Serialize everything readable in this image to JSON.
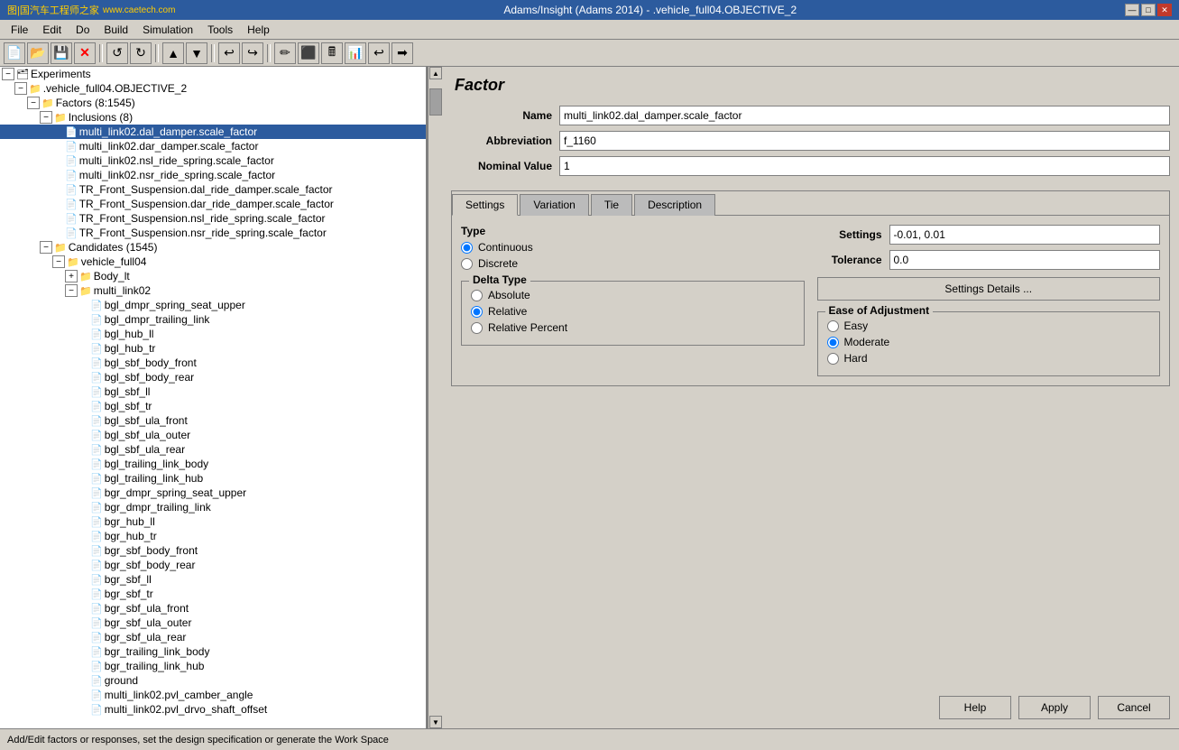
{
  "window": {
    "title": "Adams/Insight (Adams 2014) - .vehicle_full04.OBJECTIVE_2",
    "logo_text": "图|国汽车工程师之家",
    "sub_text": "www.caetech.com"
  },
  "titlebar": {
    "minimize": "—",
    "maximize": "□",
    "close": "✕"
  },
  "menu": {
    "items": [
      "File",
      "Edit",
      "Do",
      "Build",
      "Simulation",
      "Tools",
      "Help"
    ]
  },
  "toolbar_buttons": [
    "📄",
    "📂",
    "💾",
    "✕",
    "↺",
    "↻",
    "▲",
    "▼",
    "↩",
    "↪",
    "✏",
    "⬛",
    "🖩",
    "📊",
    "↩",
    "➡"
  ],
  "left_panel": {
    "tree": [
      {
        "label": "Experiments",
        "indent": 0,
        "expander": "−",
        "type": "folder"
      },
      {
        "label": ".vehicle_full04.OBJECTIVE_2",
        "indent": 1,
        "expander": "−",
        "type": "folder"
      },
      {
        "label": "Factors (8:1545)",
        "indent": 2,
        "expander": "−",
        "type": "folder"
      },
      {
        "label": "Inclusions (8)",
        "indent": 3,
        "expander": "−",
        "type": "folder"
      },
      {
        "label": "multi_link02.dal_damper.scale_factor",
        "indent": 4,
        "expander": null,
        "type": "item",
        "selected": true
      },
      {
        "label": "multi_link02.dar_damper.scale_factor",
        "indent": 4,
        "expander": null,
        "type": "item"
      },
      {
        "label": "multi_link02.nsl_ride_spring.scale_factor",
        "indent": 4,
        "expander": null,
        "type": "item"
      },
      {
        "label": "multi_link02.nsr_ride_spring.scale_factor",
        "indent": 4,
        "expander": null,
        "type": "item"
      },
      {
        "label": "TR_Front_Suspension.dal_ride_damper.scale_factor",
        "indent": 4,
        "expander": null,
        "type": "item"
      },
      {
        "label": "TR_Front_Suspension.dar_ride_damper.scale_factor",
        "indent": 4,
        "expander": null,
        "type": "item"
      },
      {
        "label": "TR_Front_Suspension.nsl_ride_spring.scale_factor",
        "indent": 4,
        "expander": null,
        "type": "item"
      },
      {
        "label": "TR_Front_Suspension.nsr_ride_spring.scale_factor",
        "indent": 4,
        "expander": null,
        "type": "item"
      },
      {
        "label": "Candidates (1545)",
        "indent": 3,
        "expander": "−",
        "type": "folder"
      },
      {
        "label": "vehicle_full04",
        "indent": 4,
        "expander": "−",
        "type": "folder"
      },
      {
        "label": "Body_lt",
        "indent": 5,
        "expander": "+",
        "type": "folder"
      },
      {
        "label": "multi_link02",
        "indent": 5,
        "expander": "−",
        "type": "folder"
      },
      {
        "label": "bgl_dmpr_spring_seat_upper",
        "indent": 6,
        "expander": null,
        "type": "item"
      },
      {
        "label": "bgl_dmpr_trailing_link",
        "indent": 6,
        "expander": null,
        "type": "item"
      },
      {
        "label": "bgl_hub_ll",
        "indent": 6,
        "expander": null,
        "type": "item"
      },
      {
        "label": "bgl_hub_tr",
        "indent": 6,
        "expander": null,
        "type": "item"
      },
      {
        "label": "bgl_sbf_body_front",
        "indent": 6,
        "expander": null,
        "type": "item"
      },
      {
        "label": "bgl_sbf_body_rear",
        "indent": 6,
        "expander": null,
        "type": "item"
      },
      {
        "label": "bgl_sbf_ll",
        "indent": 6,
        "expander": null,
        "type": "item"
      },
      {
        "label": "bgl_sbf_tr",
        "indent": 6,
        "expander": null,
        "type": "item"
      },
      {
        "label": "bgl_sbf_ula_front",
        "indent": 6,
        "expander": null,
        "type": "item"
      },
      {
        "label": "bgl_sbf_ula_outer",
        "indent": 6,
        "expander": null,
        "type": "item"
      },
      {
        "label": "bgl_sbf_ula_rear",
        "indent": 6,
        "expander": null,
        "type": "item"
      },
      {
        "label": "bgl_trailing_link_body",
        "indent": 6,
        "expander": null,
        "type": "item"
      },
      {
        "label": "bgl_trailing_link_hub",
        "indent": 6,
        "expander": null,
        "type": "item"
      },
      {
        "label": "bgr_dmpr_spring_seat_upper",
        "indent": 6,
        "expander": null,
        "type": "item"
      },
      {
        "label": "bgr_dmpr_trailing_link",
        "indent": 6,
        "expander": null,
        "type": "item"
      },
      {
        "label": "bgr_hub_ll",
        "indent": 6,
        "expander": null,
        "type": "item"
      },
      {
        "label": "bgr_hub_tr",
        "indent": 6,
        "expander": null,
        "type": "item"
      },
      {
        "label": "bgr_sbf_body_front",
        "indent": 6,
        "expander": null,
        "type": "item"
      },
      {
        "label": "bgr_sbf_body_rear",
        "indent": 6,
        "expander": null,
        "type": "item"
      },
      {
        "label": "bgr_sbf_ll",
        "indent": 6,
        "expander": null,
        "type": "item"
      },
      {
        "label": "bgr_sbf_tr",
        "indent": 6,
        "expander": null,
        "type": "item"
      },
      {
        "label": "bgr_sbf_ula_front",
        "indent": 6,
        "expander": null,
        "type": "item"
      },
      {
        "label": "bgr_sbf_ula_outer",
        "indent": 6,
        "expander": null,
        "type": "item"
      },
      {
        "label": "bgr_sbf_ula_rear",
        "indent": 6,
        "expander": null,
        "type": "item"
      },
      {
        "label": "bgr_trailing_link_body",
        "indent": 6,
        "expander": null,
        "type": "item"
      },
      {
        "label": "bgr_trailing_link_hub",
        "indent": 6,
        "expander": null,
        "type": "item"
      },
      {
        "label": "ground",
        "indent": 6,
        "expander": null,
        "type": "item"
      },
      {
        "label": "multi_link02.pvl_camber_angle",
        "indent": 6,
        "expander": null,
        "type": "item"
      },
      {
        "label": "multi_link02.pvl_drvo_shaft_offset",
        "indent": 6,
        "expander": null,
        "type": "item"
      }
    ]
  },
  "right_panel": {
    "title": "Factor",
    "fields": {
      "name_label": "Name",
      "name_value": "multi_link02.dal_damper.scale_factor",
      "abbreviation_label": "Abbreviation",
      "abbreviation_value": "f_1160",
      "nominal_label": "Nominal Value",
      "nominal_value": "1"
    },
    "tabs": [
      "Settings",
      "Variation",
      "Tie",
      "Description"
    ],
    "active_tab": "Settings",
    "settings": {
      "type_label": "Type",
      "type_options": [
        "Continuous",
        "Discrete"
      ],
      "type_selected": "Continuous",
      "settings_label": "Settings",
      "settings_value": "-0.01, 0.01",
      "tolerance_label": "Tolerance",
      "tolerance_value": "0.0",
      "settings_details_btn": "Settings Details ...",
      "delta_type": {
        "label": "Delta Type",
        "options": [
          "Absolute",
          "Relative",
          "Relative Percent"
        ],
        "selected": "Relative"
      },
      "ease_of_adjustment": {
        "label": "Ease of Adjustment",
        "options": [
          "Easy",
          "Moderate",
          "Hard"
        ],
        "selected": "Moderate"
      }
    }
  },
  "action_buttons": {
    "help": "Help",
    "apply": "Apply",
    "cancel": "Cancel"
  },
  "status_bar": {
    "text": "Add/Edit factors or responses, set the design specification or generate the Work Space"
  }
}
